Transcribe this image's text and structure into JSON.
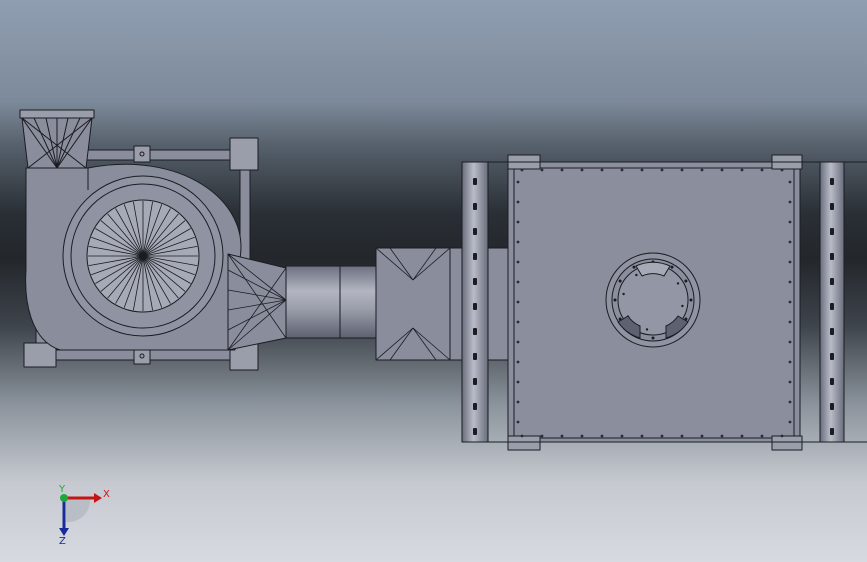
{
  "viewport": {
    "background_top": "#8f9eb1",
    "background_band": "#23272c",
    "background_bottom": "#d7dae0"
  },
  "model": {
    "body_color": "#8a8e9c",
    "edge_color": "#1b1c22",
    "components": [
      "centrifugal-fan",
      "fan-frame",
      "elbow-duct",
      "transition-flange",
      "support-rails",
      "box-housing",
      "circular-flange"
    ]
  },
  "triad": {
    "x_label": "X",
    "y_label": "Y",
    "z_label": "Z",
    "x_color": "#c31515",
    "y_color": "#1fa83a",
    "z_color": "#1a2a9a"
  }
}
